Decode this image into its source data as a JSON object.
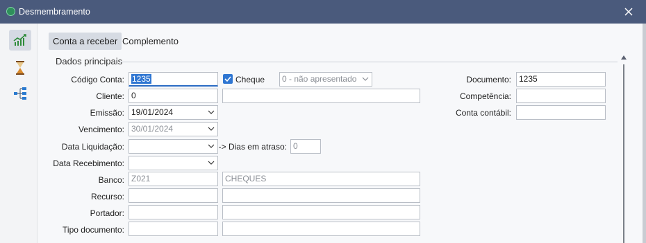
{
  "window": {
    "title": "Desmembramento",
    "close_icon": "close-icon"
  },
  "sidebar": {
    "items": [
      {
        "name": "chart-trend",
        "icon": "chart-trend-icon",
        "active": true
      },
      {
        "name": "hourglass",
        "icon": "hourglass-icon",
        "active": false
      },
      {
        "name": "hierarchy",
        "icon": "hierarchy-icon",
        "active": false
      }
    ]
  },
  "tabs": [
    {
      "label": "Conta a receber",
      "active": true
    },
    {
      "label": "Complemento",
      "active": false
    }
  ],
  "section": {
    "title": "Dados principais"
  },
  "form": {
    "codigo_conta": {
      "label": "Código Conta:",
      "value": "1235"
    },
    "cheque": {
      "label": "Cheque",
      "checked": true,
      "status_value": "0 - não apresentado"
    },
    "documento": {
      "label": "Documento:",
      "value": "1235"
    },
    "cliente": {
      "label": "Cliente:",
      "value": "0",
      "name_value": ""
    },
    "competencia": {
      "label": "Competência:",
      "value": ""
    },
    "emissao": {
      "label": "Emissão:",
      "value": "19/01/2024"
    },
    "conta_contabil": {
      "label": "Conta contábil:",
      "value": ""
    },
    "vencimento": {
      "label": "Vencimento:",
      "value": "30/01/2024"
    },
    "data_liquidacao": {
      "label": "Data Liquidação:",
      "value": ""
    },
    "dias_em_atraso": {
      "label": "-> Dias em atraso:",
      "value": "0"
    },
    "data_recebimento": {
      "label": "Data Recebimento:",
      "value": ""
    },
    "banco": {
      "label": "Banco:",
      "code": "Z021",
      "name": "CHEQUES"
    },
    "recurso": {
      "label": "Recurso:",
      "code": "",
      "name": ""
    },
    "portador": {
      "label": "Portador:",
      "code": "",
      "name": ""
    },
    "tipo_documento": {
      "label": "Tipo documento:",
      "code": "",
      "name": ""
    }
  },
  "colors": {
    "titlebar": "#4a5a7c",
    "accent": "#2f76d2",
    "tab_active": "#d6dbe3"
  }
}
